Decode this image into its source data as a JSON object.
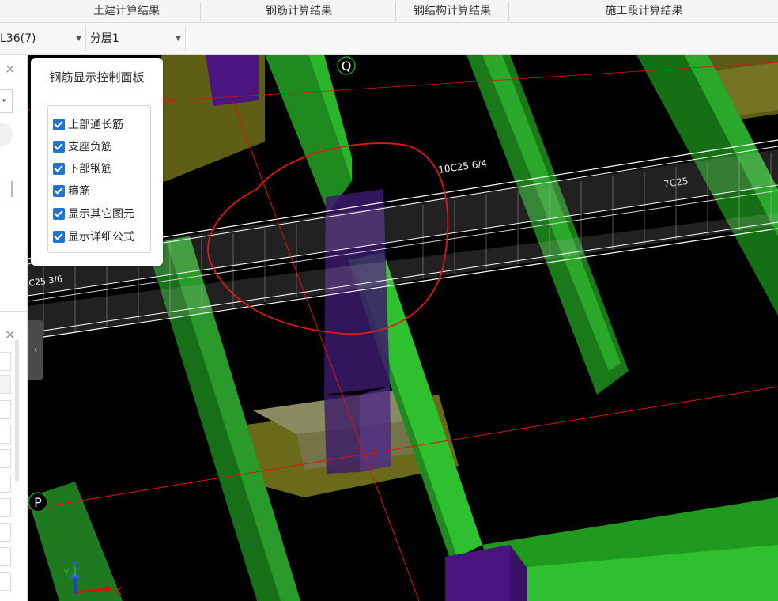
{
  "tabs": [
    {
      "label": "土建计算结果"
    },
    {
      "label": "钢筋计算结果"
    },
    {
      "label": "钢结构计算结果"
    },
    {
      "label": "施工段计算结果"
    }
  ],
  "toolbar": {
    "member_select": "L36(7)",
    "layer_select": "分层1"
  },
  "control_panel": {
    "title": "钢筋显示控制面板",
    "options": [
      {
        "label": "上部通长筋",
        "checked": true
      },
      {
        "label": "支座负筋",
        "checked": true
      },
      {
        "label": "下部钢筋",
        "checked": true
      },
      {
        "label": "箍筋",
        "checked": true
      },
      {
        "label": "显示其它图元",
        "checked": true
      },
      {
        "label": "显示详细公式",
        "checked": true
      }
    ]
  },
  "viewport": {
    "axis_q": "Q",
    "axis_p": "P",
    "rebar_label_1": "10C25 6/4",
    "rebar_label_2": "7C25",
    "rebar_label_3": "C25 3/6",
    "gizmo_x": "X",
    "gizmo_y": "Y",
    "gizmo_z": "Z"
  },
  "colors": {
    "beam_green": "#2fb52f",
    "column_purple": "#5a1a9a",
    "slab_olive": "#7a7a1a",
    "axis_red": "#e01010",
    "checkbox_blue": "#1e74d1"
  }
}
